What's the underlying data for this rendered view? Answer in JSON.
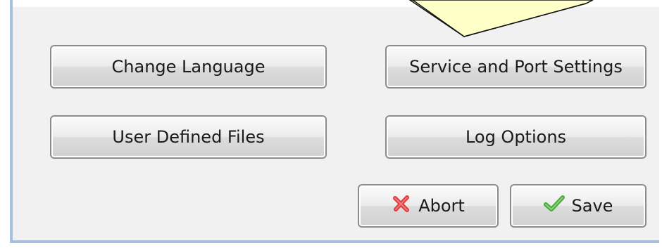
{
  "buttons": {
    "change_language": "Change Language",
    "service_port": "Service and Port Settings",
    "user_files": "User Defined Files",
    "log_options": "Log Options",
    "abort": "Abort",
    "save": "Save"
  },
  "icons": {
    "abort_icon": "x-icon",
    "save_icon": "checkmark-icon"
  },
  "colors": {
    "panel_border": "#a9c0dd",
    "callout_fill": "#ffffc8",
    "abort_red": "#e23a3a",
    "save_green": "#48a83a"
  }
}
